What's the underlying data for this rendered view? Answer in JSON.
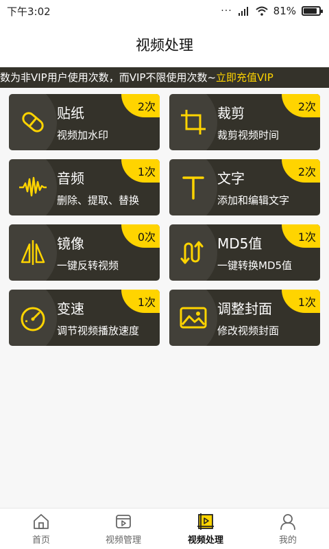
{
  "status_bar": {
    "time": "下午3:02",
    "battery": "81%"
  },
  "header": {
    "title": "视频处理"
  },
  "notice": {
    "text": "数为非VIP用户使用次数，而VIP不限使用次数~",
    "link": "立即充值VIP"
  },
  "cards": [
    {
      "title": "贴纸",
      "subtitle": "视频加水印",
      "badge": "2次",
      "icon": "bandage-icon"
    },
    {
      "title": "裁剪",
      "subtitle": "裁剪视频时间",
      "badge": "2次",
      "icon": "crop-icon"
    },
    {
      "title": "音频",
      "subtitle": "删除、提取、替换",
      "badge": "1次",
      "icon": "waveform-icon"
    },
    {
      "title": "文字",
      "subtitle": "添加和编辑文字",
      "badge": "2次",
      "icon": "text-icon"
    },
    {
      "title": "镜像",
      "subtitle": "一键反转视频",
      "badge": "0次",
      "icon": "mirror-icon"
    },
    {
      "title": "MD5值",
      "subtitle": "一键转换MD5值",
      "badge": "1次",
      "icon": "md5-icon"
    },
    {
      "title": "变速",
      "subtitle": "调节视频播放速度",
      "badge": "1次",
      "icon": "speedometer-icon"
    },
    {
      "title": "调整封面",
      "subtitle": "修改视频封面",
      "badge": "1次",
      "icon": "image-icon"
    }
  ],
  "nav": [
    {
      "label": "首页",
      "icon": "home-icon"
    },
    {
      "label": "视频管理",
      "icon": "video-manage-icon"
    },
    {
      "label": "视频处理",
      "icon": "video-process-icon",
      "active": true
    },
    {
      "label": "我的",
      "icon": "user-icon"
    }
  ],
  "colors": {
    "accent": "#ffd400",
    "card_bg": "#34322a"
  }
}
